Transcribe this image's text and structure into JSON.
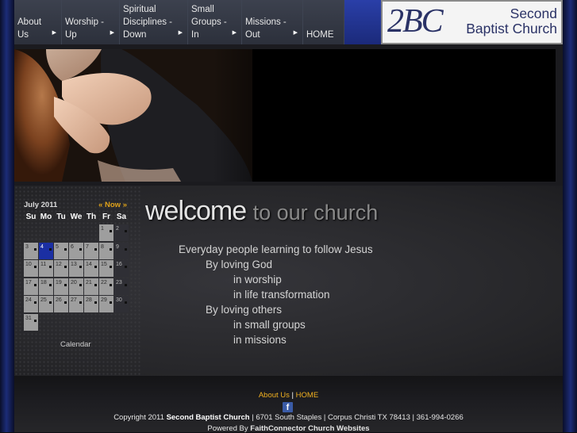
{
  "nav": [
    {
      "lines": [
        "About",
        "Us"
      ],
      "has_arrow": true
    },
    {
      "lines": [
        "Worship -",
        "Up"
      ],
      "has_arrow": true
    },
    {
      "lines": [
        "Spiritual",
        "Disciplines -",
        "Down"
      ],
      "has_arrow": true
    },
    {
      "lines": [
        "Small",
        "Groups -",
        "In"
      ],
      "has_arrow": true
    },
    {
      "lines": [
        "Missions -",
        "Out"
      ],
      "has_arrow": true
    },
    {
      "lines": [
        "HOME"
      ],
      "has_arrow": false
    }
  ],
  "logo": {
    "monogram": "2BC",
    "name_line1": "Second",
    "name_line2": "Baptist Church"
  },
  "calendar": {
    "month_label": "July 2011",
    "now_label": "« Now »",
    "weekdays": [
      "Su",
      "Mo",
      "Tu",
      "We",
      "Th",
      "Fr",
      "Sa"
    ],
    "first_weekday": 5,
    "days_in_month": 31,
    "today": 4,
    "footer_label": "Calendar"
  },
  "welcome": {
    "title": "welcome",
    "subtitle": "to our church"
  },
  "mission": {
    "line1": "Everyday people learning to follow Jesus",
    "line2": "By loving God",
    "line3": "in worship",
    "line4": "in life transformation",
    "line5": "By loving others",
    "line6": "in small groups",
    "line7": "in missions"
  },
  "footer": {
    "link_about": "About Us",
    "separator": "|",
    "link_home": "HOME",
    "facebook_icon": "f",
    "copyright_prefix": "Copyright 2011",
    "church_name": "Second Baptist Church",
    "address": "| 6701 South Staples | Corpus Christi TX 78413 | 361-994-0266",
    "powered_prefix": "Powered By",
    "powered_name": "FaithConnector Church Websites"
  },
  "colors": {
    "accent_link": "#f0b020",
    "today_cell": "#1b2fa3",
    "nav_band": "#2a3fa8"
  }
}
